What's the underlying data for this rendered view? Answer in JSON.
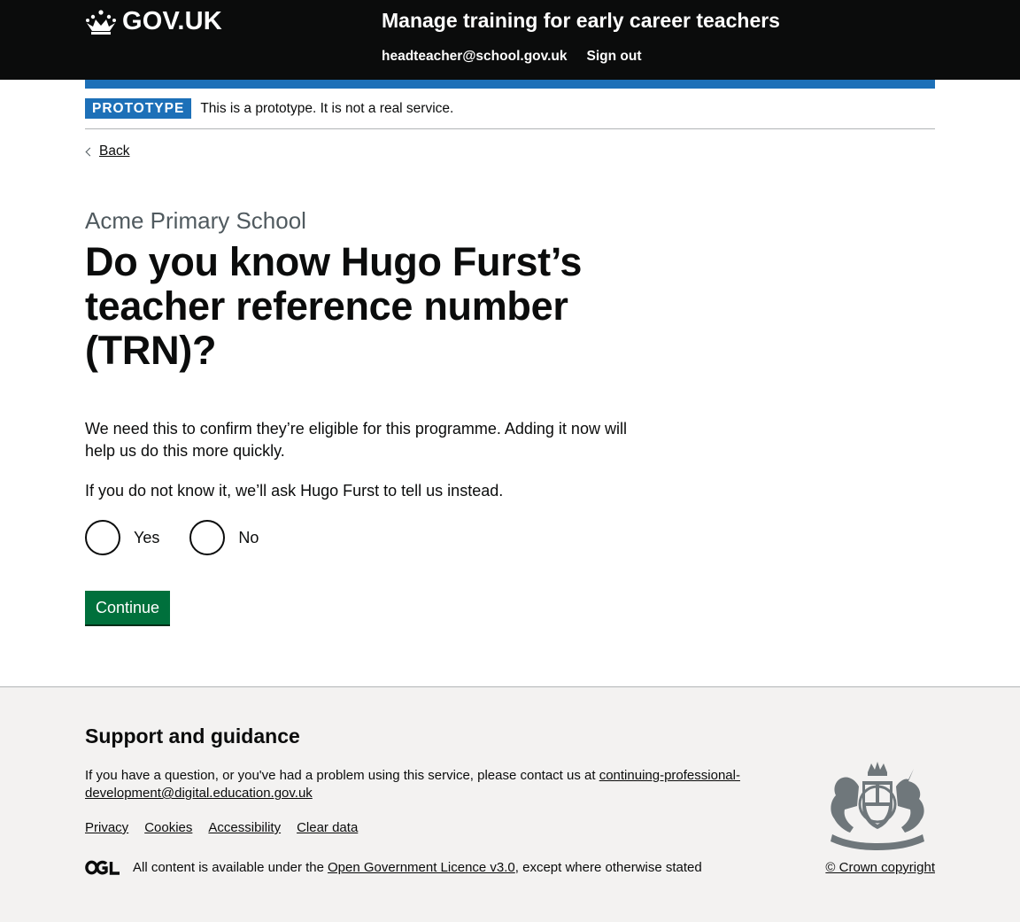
{
  "header": {
    "logo_text": "GOV.UK",
    "service_name": "Manage training for early career teachers",
    "nav": {
      "email": "headteacher@school.gov.uk",
      "sign_out": "Sign out"
    }
  },
  "phase_banner": {
    "tag": "PROTOTYPE",
    "text": "This is a prototype. It is not a real service."
  },
  "back_link": "Back",
  "main": {
    "caption": "Acme Primary School",
    "heading": "Do you know Hugo Furst’s teacher reference number (TRN)?",
    "paragraph_1": "We need this to confirm they’re eligible for this programme. Adding it now will help us do this more quickly.",
    "paragraph_2": "If you do not know it, we’ll ask Hugo Furst to tell us instead.",
    "radios": [
      {
        "label": "Yes",
        "selected": false
      },
      {
        "label": "No",
        "selected": false
      }
    ],
    "continue_label": "Continue"
  },
  "footer": {
    "heading": "Support and guidance",
    "contact_text": "If you have a question, or you've had a problem using this service, please contact us at ",
    "contact_email": "continuing-professional-development@digital.education.gov.uk",
    "links": [
      "Privacy",
      "Cookies",
      "Accessibility",
      "Clear data"
    ],
    "licence_prefix": "All content is available under the ",
    "licence_link": "Open Government Licence v3.0",
    "licence_suffix": ", except where otherwise stated",
    "copyright": "© Crown copyright"
  },
  "colors": {
    "header_bg": "#0b0c0c",
    "brand_blue": "#1d70b8",
    "button_green": "#00703c",
    "footer_bg": "#f3f2f1",
    "secondary_text": "#505a5f"
  },
  "icons": {
    "logo": "crown-icon",
    "back": "chevron-left-icon",
    "licence": "ogl-logo-icon",
    "crest": "royal-coat-of-arms-icon"
  }
}
